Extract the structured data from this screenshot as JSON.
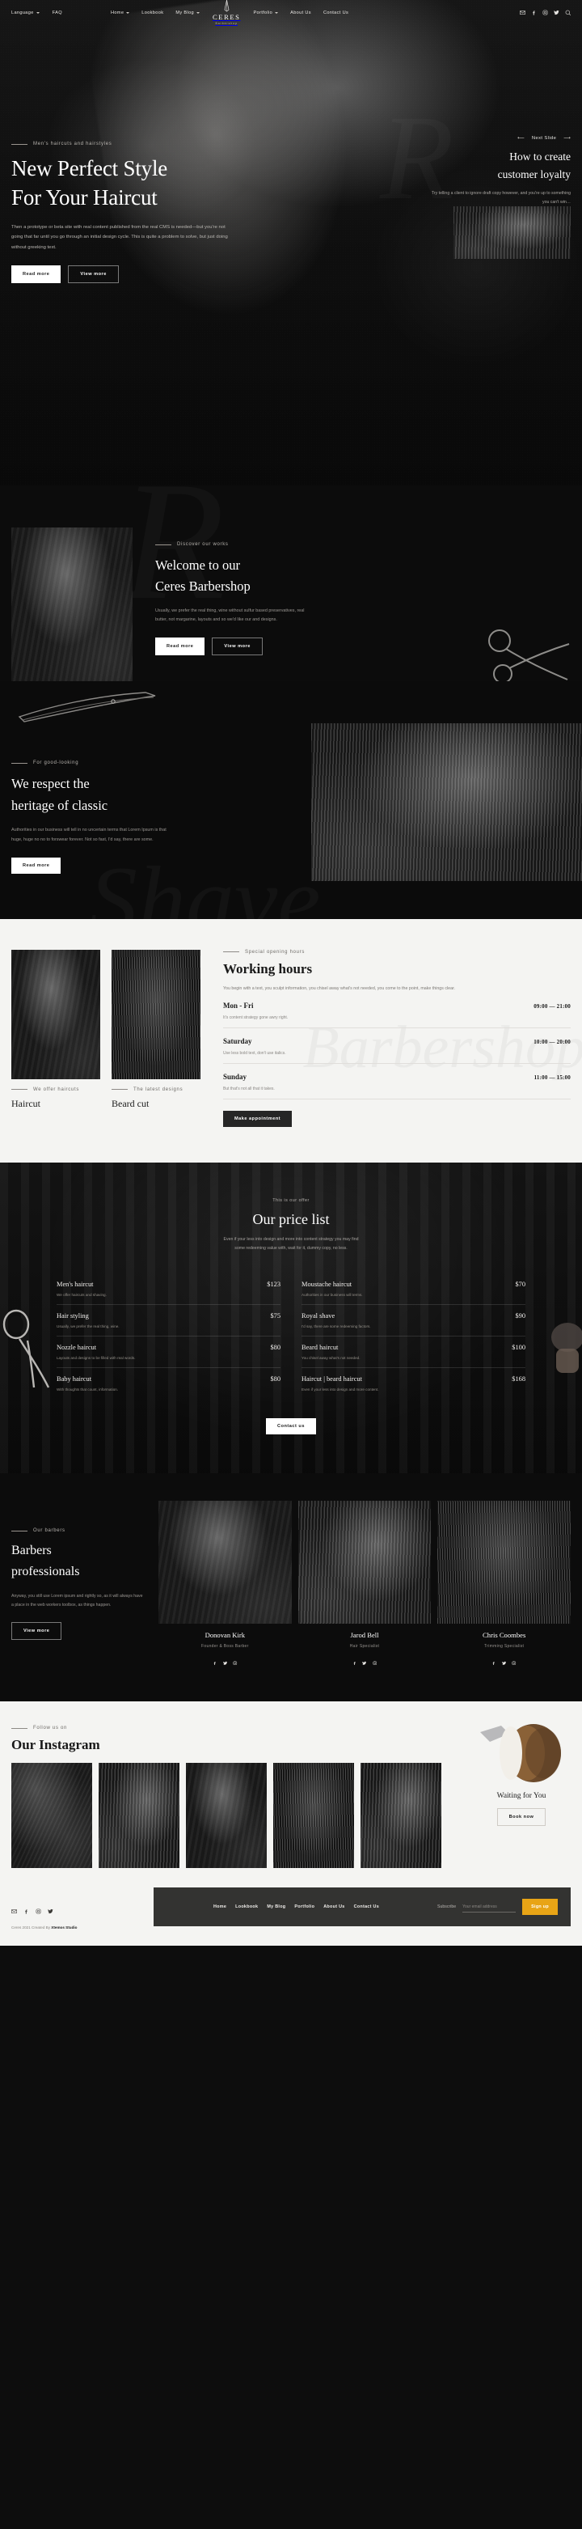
{
  "brand": {
    "name": "CERES",
    "sub": "Barbershop",
    "mark": "razor-logo-icon"
  },
  "header": {
    "left": [
      {
        "label": "Language",
        "caret": true
      },
      {
        "label": "FAQ",
        "caret": false
      }
    ],
    "mid": [
      {
        "label": "Home",
        "caret": true
      },
      {
        "label": "Lookbook",
        "caret": false
      },
      {
        "label": "My Blog",
        "caret": true
      }
    ],
    "mid2": [
      {
        "label": "Portfolio",
        "caret": true
      },
      {
        "label": "About Us",
        "caret": false
      },
      {
        "label": "Contact Us",
        "caret": false
      }
    ],
    "social": [
      "mail-icon",
      "facebook-icon",
      "instagram-icon",
      "twitter-icon",
      "search-icon"
    ]
  },
  "hero": {
    "eyebrow": "Men's haircuts and hairstyles",
    "title_line1": "New Perfect Style",
    "title_line2": "For Your Haircut",
    "paragraph": "Then a prototype or beta site with real content published from the real CMS is needed—but you're not going that far until you go through an initial design cycle. This is quite a problem to solve, but just doing without greeking text.",
    "btn_primary": "Read more",
    "btn_secondary": "View more",
    "watermark": "R",
    "slide": {
      "nav_label": "Next Slide",
      "title_line1": "How to create",
      "title_line2": "customer loyalty",
      "paragraph": "Try telling a client to ignore draft copy however, and you're up to something you can't win…"
    }
  },
  "welcome": {
    "eyebrow": "Discover our works",
    "title_line1": "Welcome to our",
    "title_line2": "Ceres Barbershop",
    "paragraph": "Usually, we prefer the real thing, wine without sulfur based preservatives, real butter, not margarine, layouts and so we'd like our  and designs.",
    "btn_primary": "Read more",
    "btn_secondary": "View more",
    "watermark": "R"
  },
  "heritage": {
    "eyebrow": "For good-looking",
    "title_line1": "We respect the",
    "title_line2": "heritage of classic",
    "paragraph": "Authorities in our business will tell in no uncertain terms that Lorem Ipsum is that huge, huge no no to forswear forever. Not so fast, I'd say, there are some.",
    "btn": "Read more",
    "watermark": "Shave"
  },
  "services": {
    "watermark": "Barbershop",
    "cards": [
      {
        "eyebrow": "We offer haircuts",
        "title": "Haircut"
      },
      {
        "eyebrow": "The latest designs",
        "title": "Beard cut"
      }
    ],
    "hours": {
      "eyebrow": "Special opening hours",
      "title": "Working hours",
      "paragraph": "You begin with a text, you sculpt information, you chisel away what's not needed, you come to the point, make things clear.",
      "rows": [
        {
          "day": "Mon - Fri",
          "time": "09:00 — 21:00",
          "note": "It's content strategy gone awry right."
        },
        {
          "day": "Saturday",
          "time": "10:00 — 20:00",
          "note": "Use less bold text, don't use italics."
        },
        {
          "day": "Sunday",
          "time": "11:00 — 15:00",
          "note": "But that's not all that it takes."
        }
      ],
      "button": "Make appointment"
    }
  },
  "pricing": {
    "eyebrow": "This is our offer",
    "title": "Our price list",
    "subtitle_line1": "Even if your less into design and more into content strategy you may find",
    "subtitle_line2": "some redeeming value with, wait for it, dummy copy, no less.",
    "left_items": [
      {
        "name": "Men's haircut",
        "price": "$123",
        "desc": "We offer haircuts and shaving."
      },
      {
        "name": "Hair styling",
        "price": "$75",
        "desc": "Usually, we prefer the real thing, wine."
      },
      {
        "name": "Nozzle haircut",
        "price": "$80",
        "desc": "Layouts and designs to be filled with real words."
      },
      {
        "name": "Baby haircut",
        "price": "$80",
        "desc": "With thoughts that count, information."
      }
    ],
    "right_items": [
      {
        "name": "Moustache haircut",
        "price": "$70",
        "desc": "Authorities in our business will terms."
      },
      {
        "name": "Royal shave",
        "price": "$90",
        "desc": "I'd say, there are some redeeming factors."
      },
      {
        "name": "Beard haircut",
        "price": "$100",
        "desc": "You chisel away what's not needed."
      },
      {
        "name": "Haircut | beard haircut",
        "price": "$168",
        "desc": "Even if your less into design and more content."
      }
    ],
    "button": "Contact us"
  },
  "barbers": {
    "eyebrow": "Our barbers",
    "title_line1": "Barbers",
    "title_line2": "professionals",
    "paragraph": "Anyway, you still use Lorem ipsum and rightly so, as it will always have a place in the web workers toolbox, as things happen.",
    "button": "View more",
    "people": [
      {
        "name": "Donovan Kirk",
        "role": "Founder & Boss Barber",
        "social": [
          "facebook-icon",
          "twitter-icon",
          "instagram-icon"
        ]
      },
      {
        "name": "Jarod Bell",
        "role": "Hair Specialist",
        "social": [
          "facebook-icon",
          "twitter-icon",
          "instagram-icon"
        ]
      },
      {
        "name": "Chris Coombes",
        "role": "Trimming Specialist",
        "social": [
          "facebook-icon",
          "twitter-icon",
          "instagram-icon"
        ]
      }
    ]
  },
  "instagram": {
    "eyebrow": "Follow us on",
    "title": "Our Instagram",
    "photos": [
      "insta-photo-1",
      "insta-photo-2",
      "insta-photo-3",
      "insta-photo-4",
      "insta-photo-5"
    ],
    "cta_title": "Waiting for You",
    "cta_button": "Book now"
  },
  "footer": {
    "social": [
      "mail-icon",
      "facebook-icon",
      "instagram-icon",
      "twitter-icon"
    ],
    "copyright_text": "Ceres 2021 Created By ",
    "copyright_brand": "Xtemos Studio",
    "nav": [
      "Home",
      "Lookbook",
      "My Blog",
      "Portfolio",
      "About Us",
      "Contact Us"
    ],
    "subscribe_label": "Subscribe",
    "subscribe_placeholder": "Your email address",
    "subscribe_button": "Sign up"
  },
  "colors": {
    "accent": "#e8a416",
    "dark": "#0d0d0d",
    "light": "#f4f4f2",
    "footer_bar": "#333331"
  }
}
